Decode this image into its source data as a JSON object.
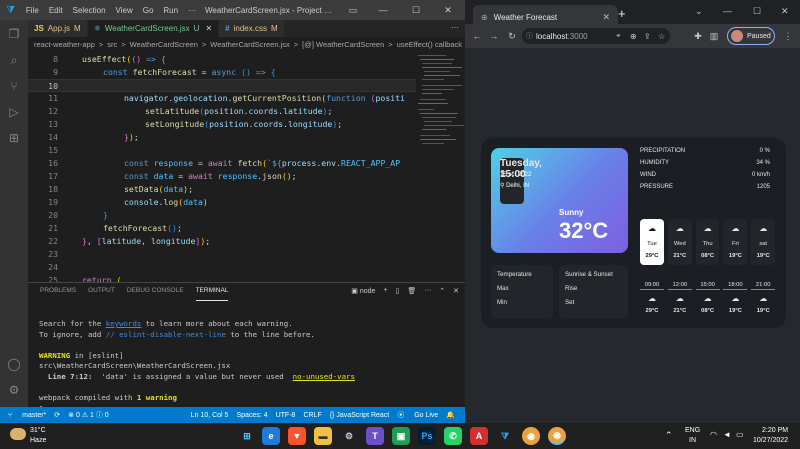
{
  "vscode": {
    "menus": [
      "File",
      "Edit",
      "Selection",
      "View",
      "Go",
      "Run"
    ],
    "more": "···",
    "title": "WeatherCardScreen.jsx - Project weather foreca...",
    "tabs": [
      {
        "name": "App.js",
        "tag": "M",
        "icon": "JS"
      },
      {
        "name": "WeatherCardScreen.jsx",
        "tag": "U",
        "icon": "⚛"
      },
      {
        "name": "index.css",
        "tag": "M",
        "icon": "#"
      }
    ],
    "breadcrumb": [
      "react-weather-app",
      ">",
      "src",
      ">",
      "WeatherCardScreen",
      ">",
      "WeatherCardScreen.jsx",
      ">",
      "[@] WeatherCardScreen",
      ">",
      "useEffect() callback"
    ],
    "lines": [
      {
        "n": "8"
      },
      {
        "n": "9"
      },
      {
        "n": "10"
      },
      {
        "n": "11"
      },
      {
        "n": "12"
      },
      {
        "n": "13"
      },
      {
        "n": "14"
      },
      {
        "n": "15"
      },
      {
        "n": "16"
      },
      {
        "n": "17"
      },
      {
        "n": "18"
      },
      {
        "n": "19"
      },
      {
        "n": "20"
      },
      {
        "n": "21"
      },
      {
        "n": "22"
      },
      {
        "n": "23"
      },
      {
        "n": "24"
      },
      {
        "n": "25"
      }
    ],
    "panel_tabs": [
      "PROBLEMS",
      "OUTPUT",
      "DEBUG CONSOLE",
      "TERMINAL"
    ],
    "panel_tools": {
      "shell": "node",
      "add": "+",
      "split": "▯",
      "trash": "🗑",
      "more": "···",
      "maximize": "⌃",
      "close": "✕"
    },
    "terminal": {
      "l1a": "Search for the ",
      "l1b": "keywords",
      "l1c": " to learn more about each warning.",
      "l2a": "To ignore, add ",
      "l2b": "// eslint-disable-next-line",
      "l2c": " to the line before.",
      "l3a": "WARNING",
      "l3b": " in [eslint]",
      "l4": "src\\WeatherCardScreen\\WeatherCardScreen.jsx",
      "l5a": "  Line 7:12:",
      "l5b": "  'data' is assigned a value but never used  ",
      "l5c": "no-unused-vars",
      "l6a": "webpack compiled with ",
      "l6b": "1 warning"
    },
    "status": {
      "branch": "master*",
      "sync": "⟳",
      "problems": "⊗ 0 ⚠ 1 ⓘ 0",
      "position": "Ln 10, Col 5",
      "spaces": "Spaces: 4",
      "encoding": "UTF-8",
      "eol": "CRLF",
      "language": "{} JavaScript React",
      "live": "Go Live",
      "bell": "🔔"
    }
  },
  "browser": {
    "tab_title": "Weather Forecast",
    "tab_close": "✕",
    "new_tab": "+",
    "url_host": "localhost",
    "url_port": ":3000",
    "profile_status": "Paused",
    "weather": {
      "day_time": "Tuesday, 15:00",
      "date": "15 oct 2022",
      "location": "Delhi, IN",
      "condition": "Sunny",
      "temperature": "32°C",
      "stats": [
        {
          "label": "PRECIPITATION",
          "value": "0 %"
        },
        {
          "label": "HUMIDITY",
          "value": "34 %"
        },
        {
          "label": "WIND",
          "value": "0 km/h"
        },
        {
          "label": "PRESSURE",
          "value": "1205"
        }
      ],
      "left_box": {
        "a": "Temperature",
        "b": "Max",
        "c": "Min"
      },
      "right_box": {
        "a": "Sunrise & Sunset",
        "b": "Rise",
        "c": "Set"
      },
      "days": [
        {
          "name": "Tue",
          "temp": "29°C"
        },
        {
          "name": "Wed",
          "temp": "21°C"
        },
        {
          "name": "Thu",
          "temp": "08°C"
        },
        {
          "name": "Fri",
          "temp": "19°C"
        },
        {
          "name": "sat",
          "temp": "19°C"
        }
      ],
      "hours": [
        {
          "time": "09:00",
          "temp": "29°C"
        },
        {
          "time": "12:00",
          "temp": "21°C"
        },
        {
          "time": "15:00",
          "temp": "08°C"
        },
        {
          "time": "18:00",
          "temp": "19°C"
        },
        {
          "time": "21:00",
          "temp": "19°C"
        }
      ]
    }
  },
  "taskbar": {
    "weather_temp": "31°C",
    "weather_cond": "Haze",
    "lang_top": "ENG",
    "lang_bottom": "IN",
    "time": "2:20 PM",
    "date": "10/27/2022"
  }
}
